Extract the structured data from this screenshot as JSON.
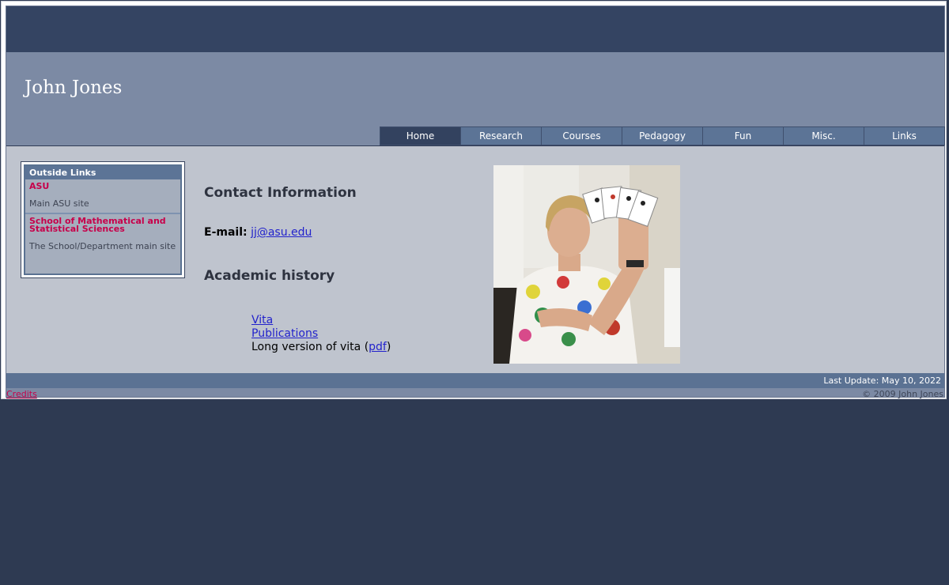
{
  "header": {
    "title": "John Jones"
  },
  "nav": {
    "items": [
      "Home",
      "Research",
      "Courses",
      "Pedagogy",
      "Fun",
      "Misc.",
      "Links"
    ],
    "active": "Home"
  },
  "sidebar": {
    "heading": "Outside Links",
    "links": [
      {
        "label": "ASU",
        "description": "Main ASU site"
      },
      {
        "label": "School of Mathematical and Statistical Sciences",
        "description": "The School/Department main site"
      }
    ]
  },
  "main": {
    "contact_heading": "Contact Information",
    "email_label": "E-mail:",
    "email_value": "jj@asu.edu",
    "academic_heading": "Academic history",
    "vita_label": "Vita",
    "publications_label": "Publications",
    "long_vita_prefix": "Long version of vita (",
    "long_vita_link": "pdf",
    "long_vita_suffix": ")"
  },
  "footer": {
    "last_update": "Last Update: May 10, 2022",
    "credits": "Credits",
    "copyright": "© 2009 John Jones"
  },
  "colors": {
    "background": "#2e3a52",
    "top_bar": "#344462",
    "header_band": "#7c8aa4",
    "content_bg": "#bfc4ce",
    "nav_tab": "#5c7496",
    "nav_active": "#33425f",
    "accent_link": "#c7004a",
    "hyperlink": "#2222cc"
  }
}
